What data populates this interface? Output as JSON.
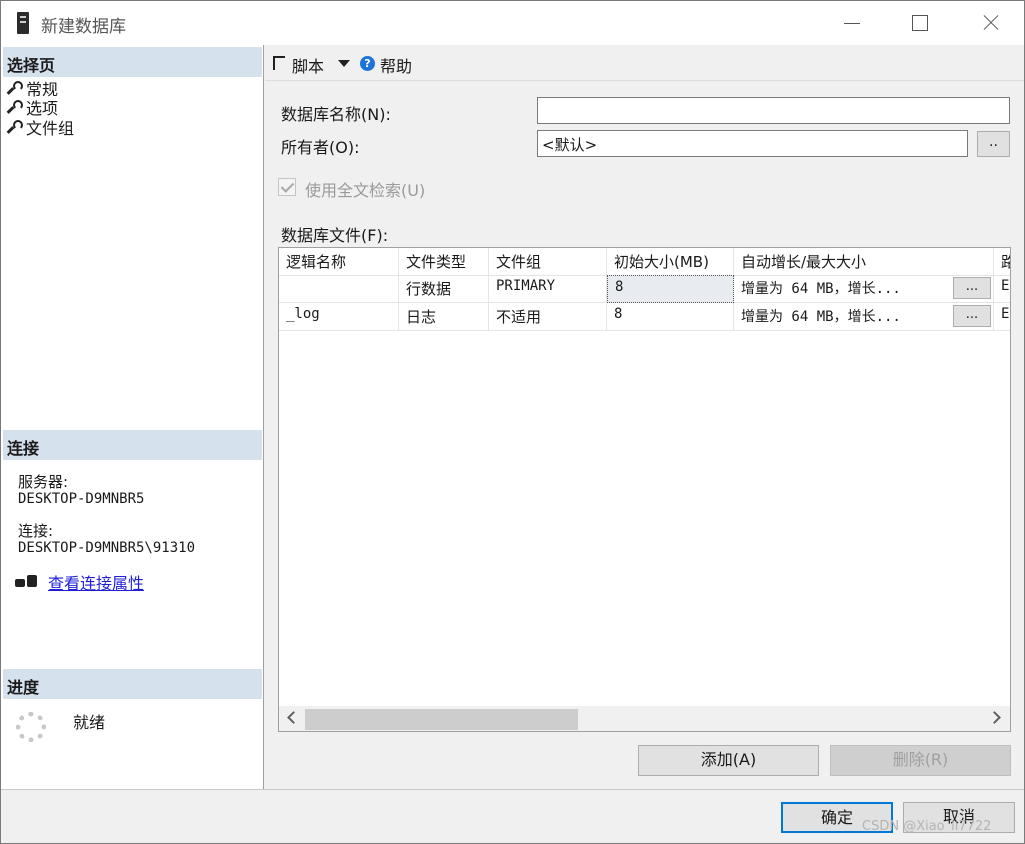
{
  "window": {
    "title": "新建数据库"
  },
  "left": {
    "select_page_header": "选择页",
    "pages": [
      "常规",
      "选项",
      "文件组"
    ],
    "connection_header": "连接",
    "server_label": "服务器:",
    "server_value": "DESKTOP-D9MNBR5",
    "connection_label": "连接:",
    "connection_value": "DESKTOP-D9MNBR5\\91310",
    "view_props_link": "查看连接属性",
    "progress_header": "进度",
    "progress_status": "就绪"
  },
  "toolbar": {
    "script_label": "脚本",
    "help_label": "帮助"
  },
  "form": {
    "db_name_label": "数据库名称(N):",
    "db_name_value": "",
    "owner_label": "所有者(O):",
    "owner_value": "<默认>",
    "browse_label": "..",
    "fulltext_label": "使用全文检索(U)",
    "fulltext_checked": true,
    "db_files_label": "数据库文件(F):"
  },
  "grid": {
    "columns": [
      "逻辑名称",
      "文件类型",
      "文件组",
      "初始大小(MB)",
      "自动增长/最大大小",
      "路"
    ],
    "rows": [
      {
        "name": "",
        "type": "行数据",
        "group": "PRIMARY",
        "size": "8",
        "growth": "增量为 64 MB，增长...",
        "btn": "...",
        "path": "E"
      },
      {
        "name": "_log",
        "type": "日志",
        "group": "不适用",
        "size": "8",
        "growth": "增量为 64 MB，增长...",
        "btn": "...",
        "path": "E"
      }
    ]
  },
  "buttons": {
    "add": "添加(A)",
    "remove": "删除(R)",
    "ok": "确定",
    "cancel": "取消"
  },
  "watermark": "CSDN @Xiao_li7722",
  "colors": {
    "section_header": "#d5e1ed",
    "accent": "#0078d7",
    "link": "#1f1fd8"
  }
}
